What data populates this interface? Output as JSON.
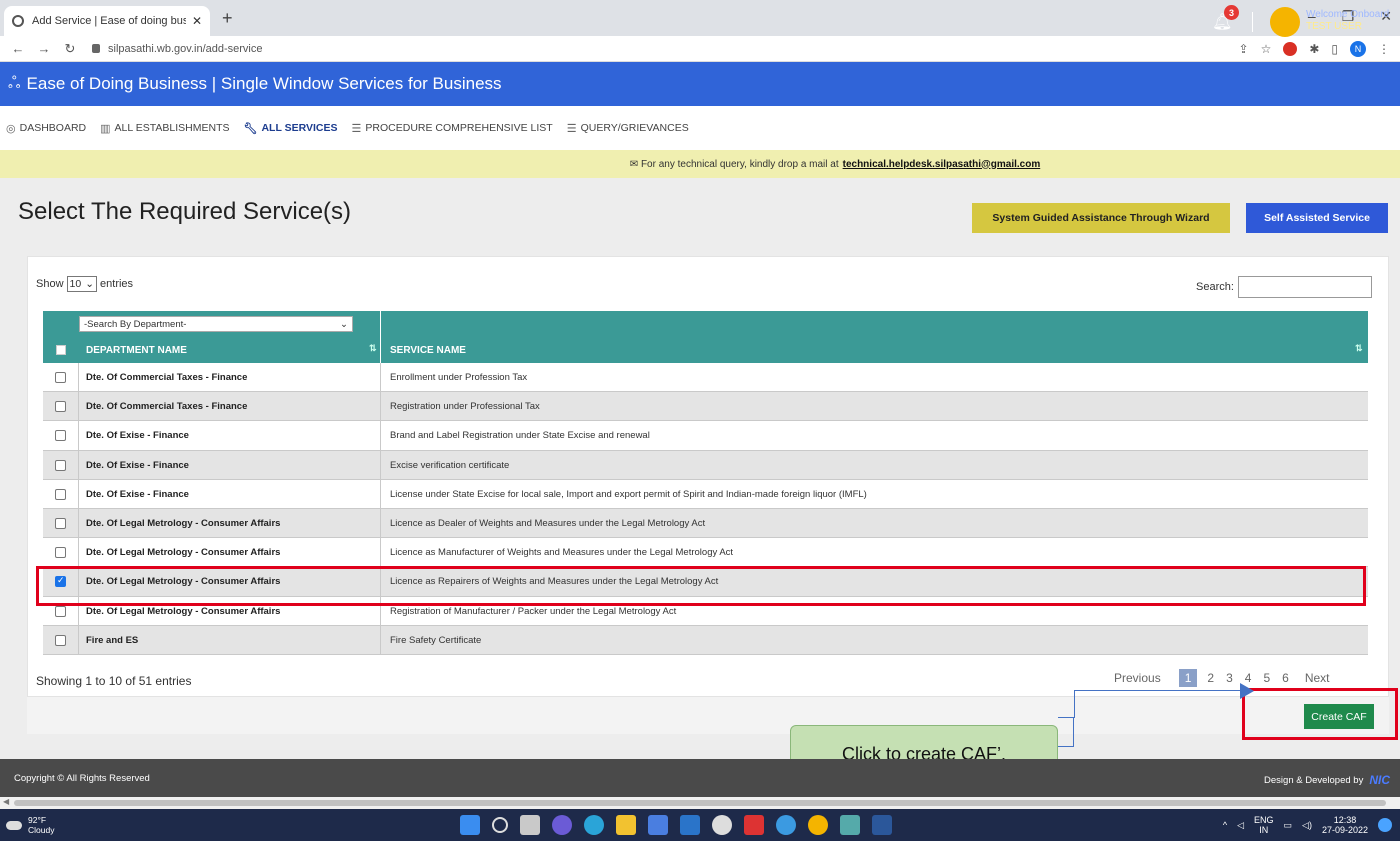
{
  "browser": {
    "tab_title": "Add Service | Ease of doing busi",
    "url": "silpasathi.wb.gov.in/add-service",
    "profile_initial": "N"
  },
  "header": {
    "title": "Ease of Doing Business | Single Window Services for Business",
    "notification_count": "3",
    "welcome_text": "Welcome Onboard",
    "user_name": "TEST USER"
  },
  "menu": {
    "items": [
      {
        "label": "DASHBOARD",
        "icon": "dashboard-icon"
      },
      {
        "label": "ALL ESTABLISHMENTS",
        "icon": "building-icon"
      },
      {
        "label": "ALL SERVICES",
        "icon": "wrench-icon"
      },
      {
        "label": "PROCEDURE COMPREHENSIVE LIST",
        "icon": "list-icon"
      },
      {
        "label": "QUERY/GRIEVANCES",
        "icon": "list-icon"
      }
    ]
  },
  "notice": {
    "text": "For any technical query, kindly drop a mail at",
    "email": "technical.helpdesk.silpasathi@gmail.com"
  },
  "page": {
    "heading": "Select The Required Service(s)",
    "wizard_button": "System Guided Assistance Through Wizard",
    "self_button": "Self Assisted Service"
  },
  "table": {
    "show_label": "Show",
    "entries_value": "10",
    "entries_label": "entries",
    "search_label": "Search:",
    "dept_filter": "-Search By Department-",
    "col_department": "DEPARTMENT NAME",
    "col_service": "SERVICE NAME",
    "rows": [
      {
        "dept": "Dte. Of Commercial Taxes - Finance",
        "service": "Enrollment under Profession Tax",
        "checked": false
      },
      {
        "dept": "Dte. Of Commercial Taxes - Finance",
        "service": "Registration under Professional Tax",
        "checked": false
      },
      {
        "dept": "Dte. Of Exise - Finance",
        "service": "Brand and Label Registration under State Excise and renewal",
        "checked": false
      },
      {
        "dept": "Dte. Of Exise - Finance",
        "service": "Excise verification certificate",
        "checked": false
      },
      {
        "dept": "Dte. Of Exise - Finance",
        "service": "License under State Excise for local sale, Import and export permit of Spirit and Indian-made foreign liquor (IMFL)",
        "checked": false
      },
      {
        "dept": "Dte. Of Legal Metrology - Consumer Affairs",
        "service": "Licence as Dealer of Weights and Measures under the Legal Metrology Act",
        "checked": false
      },
      {
        "dept": "Dte. Of Legal Metrology - Consumer Affairs",
        "service": "Licence as Manufacturer of Weights and Measures under the Legal Metrology Act",
        "checked": false
      },
      {
        "dept": "Dte. Of Legal Metrology - Consumer Affairs",
        "service": "Licence as Repairers of Weights and Measures under the Legal Metrology Act",
        "checked": true
      },
      {
        "dept": "Dte. Of Legal Metrology - Consumer Affairs",
        "service": "Registration of Manufacturer / Packer under the Legal Metrology Act",
        "checked": false
      },
      {
        "dept": "Fire and ES",
        "service": "Fire Safety Certificate",
        "checked": false
      }
    ],
    "info": "Showing 1 to 10 of 51 entries",
    "pager": {
      "previous": "Previous",
      "pages": [
        "1",
        "2",
        "3",
        "4",
        "5",
        "6"
      ],
      "current": "1",
      "next": "Next"
    }
  },
  "actions": {
    "create_caf": "Create CAF",
    "callout": "Click to create CAF’."
  },
  "footer": {
    "copyright": "Copyright © All Rights Reserved",
    "developed": "Design & Developed by",
    "logo": "NIC"
  },
  "taskbar": {
    "temperature": "92°F",
    "weather": "Cloudy",
    "lang": "ENG",
    "region": "IN",
    "time": "12:38",
    "date": "27-09-2022"
  },
  "colors": {
    "header_blue": "#3064d8",
    "table_teal": "#3b9a96",
    "highlight_red": "#e0001b",
    "caf_green": "#1f8a4c"
  }
}
